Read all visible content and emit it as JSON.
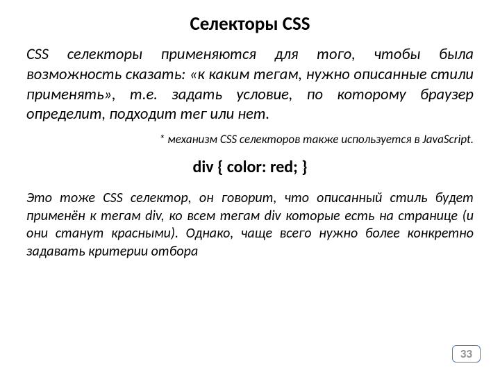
{
  "title": "Селекторы CSS",
  "intro": "CSS селекторы применяются для того, чтобы была возможность сказать: «к каким тегам, нужно описанные стили применять», т.е. задать условие, по которому браузер определит, подходит тег или нет.",
  "note": "* механизм CSS селекторов также используется в JavaScript.",
  "code": "div { color: red; }",
  "explain": "Это тоже CSS селектор, он говорит, что описанный стиль будет применён к тегам div, ко всем тегам div которые есть на странице (и они станут красными). Однако, чаще всего нужно более конкретно задавать критерии отбора",
  "page_number": "33"
}
